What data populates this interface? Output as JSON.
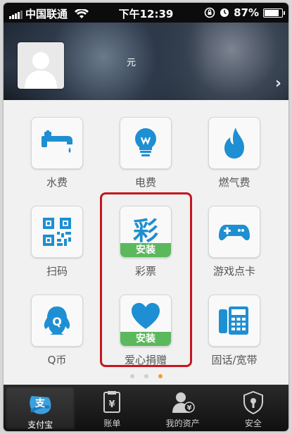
{
  "status_bar": {
    "carrier": "中国联通",
    "time": "下午12:39",
    "battery": "87%",
    "battery_level": 0.87
  },
  "header": {
    "username": "元"
  },
  "apps": [
    {
      "label": "水费",
      "icon": "faucet-icon",
      "install": ""
    },
    {
      "label": "电费",
      "icon": "lightbulb-icon",
      "install": ""
    },
    {
      "label": "燃气费",
      "icon": "flame-icon",
      "install": ""
    },
    {
      "label": "扫码",
      "icon": "qr-code-icon",
      "install": ""
    },
    {
      "label": "彩票",
      "icon": "lottery-icon",
      "install": "安装",
      "icon_text": "彩"
    },
    {
      "label": "游戏点卡",
      "icon": "gamepad-icon",
      "install": ""
    },
    {
      "label": "Q币",
      "icon": "qq-penguin-icon",
      "install": ""
    },
    {
      "label": "爱心捐赠",
      "icon": "heart-icon",
      "install": "安装"
    },
    {
      "label": "固话/宽带",
      "icon": "phone-icon",
      "install": ""
    }
  ],
  "pager": {
    "pages": 3,
    "current": 3
  },
  "tabbar": {
    "items": [
      {
        "label": "支付宝",
        "icon": "alipay-icon",
        "active": true
      },
      {
        "label": "账单",
        "icon": "bill-icon",
        "active": false
      },
      {
        "label": "我的资产",
        "icon": "assets-icon",
        "active": false
      },
      {
        "label": "安全",
        "icon": "shield-icon",
        "active": false
      }
    ]
  },
  "colors": {
    "accent_blue": "#1e8fd2",
    "install_green": "#5cb85c",
    "highlight_red": "#c51720",
    "active_dot": "#f0a030"
  }
}
